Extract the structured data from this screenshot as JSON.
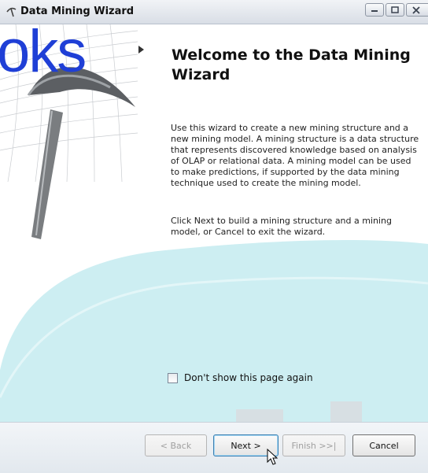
{
  "window": {
    "title": "Data Mining Wizard",
    "controls": [
      "minimize-icon",
      "maximize-icon",
      "close-icon"
    ]
  },
  "overlay": {
    "text": "oks"
  },
  "main": {
    "heading": "Welcome to the Data Mining Wizard",
    "paragraph1": "Use this wizard to create a new mining structure and a new mining model. A mining structure is a data structure that represents discovered knowledge based on analysis of OLAP or relational data.  A mining model can be used to make predictions, if supported by the data mining technique used to create the mining model.",
    "paragraph2": "Click Next to build a mining structure and a mining model, or Cancel to exit the wizard.",
    "checkbox": {
      "label": "Don't show this page again",
      "checked": false
    }
  },
  "buttons": {
    "back": "< Back",
    "next": "Next >",
    "finish": "Finish >>|",
    "cancel": "Cancel"
  },
  "colors": {
    "overlay_text": "#1f3fd6",
    "wave": "#cdeef2"
  }
}
